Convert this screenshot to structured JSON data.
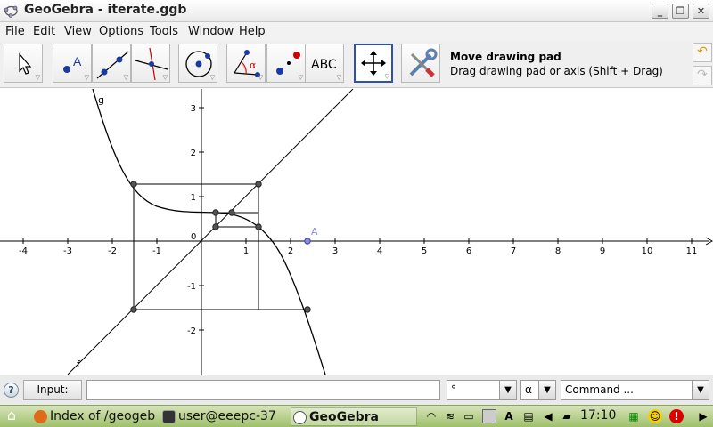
{
  "window": {
    "title": "GeoGebra - iterate.ggb",
    "controls": [
      "minimize",
      "maximize",
      "close"
    ]
  },
  "menu": [
    "File",
    "Edit",
    "View",
    "Options",
    "Tools",
    "Window",
    "Help"
  ],
  "toolbar": {
    "tools": [
      {
        "name": "move-tool",
        "icon": "arrow-pointer-icon"
      },
      {
        "name": "point-tool",
        "icon": "point-A-icon"
      },
      {
        "name": "line-tool",
        "icon": "line-through-points-icon"
      },
      {
        "name": "perpendicular-tool",
        "icon": "perpendicular-line-icon"
      },
      {
        "name": "circle-tool",
        "icon": "circle-center-point-icon"
      },
      {
        "name": "angle-tool",
        "icon": "angle-alpha-icon"
      },
      {
        "name": "reflect-tool",
        "icon": "reflect-point-icon"
      },
      {
        "name": "text-tool",
        "icon": "text-ABC-icon",
        "label": "ABC"
      },
      {
        "name": "move-graphics-tool",
        "icon": "move-cross-arrows-icon",
        "selected": true
      },
      {
        "name": "properties-tool",
        "icon": "wrench-screwdriver-icon"
      }
    ],
    "help_title": "Move drawing pad",
    "help_desc": "Drag drawing pad or axis (Shift + Drag)"
  },
  "graphics": {
    "x_ticks": [
      "-4",
      "-3",
      "-2",
      "-1",
      "0",
      "1",
      "2",
      "3",
      "4",
      "5",
      "6",
      "7",
      "8",
      "9",
      "10",
      "11"
    ],
    "y_ticks": [
      "3",
      "2",
      "1",
      "-1",
      "-2"
    ],
    "label_g": "g",
    "label_f": "f",
    "label_A": "A"
  },
  "inputbar": {
    "help_icon": "?",
    "input_label": "Input:",
    "input_value": "",
    "degree_symbol": "°",
    "alpha_symbol": "α",
    "command_placeholder": "Command ..."
  },
  "taskbar": {
    "tasks": [
      {
        "label": "Index of /geogeb",
        "icon": "firefox-icon"
      },
      {
        "label": "user@eeepc-37",
        "icon": "terminal-icon"
      },
      {
        "label": "GeoGebra",
        "icon": "geogebra-icon",
        "active": true
      }
    ],
    "clock": "17:10"
  },
  "colors": {
    "accent_selected": "#3050b0",
    "taskbar_green": "#9fc06a",
    "point_A": "#8a8ae0"
  }
}
